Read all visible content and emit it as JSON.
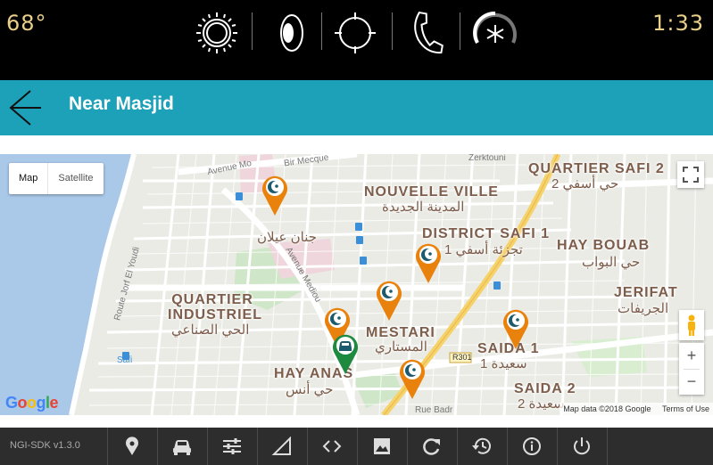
{
  "status": {
    "temperature": "68°",
    "time": "1:33",
    "icons": [
      "sun-icon",
      "speaker-icon",
      "navigation-crosshair-icon",
      "phone-icon",
      "climate-snowflake-icon"
    ]
  },
  "header": {
    "title": "Near Masjid"
  },
  "map": {
    "type_controls": {
      "map": "Map",
      "satellite": "Satellite"
    },
    "districts": [
      {
        "name": "NOUVELLE VILLE",
        "arabic": "المدينة الجديدة"
      },
      {
        "name": "QUARTIER SAFI 2",
        "arabic": "حي أسفي 2"
      },
      {
        "name": "DISTRICT SAFI 1",
        "arabic": "تجزئة أسفي 1"
      },
      {
        "name": "HAY BOUAB",
        "arabic": "حي البواب"
      },
      {
        "name": "JERIFAT",
        "arabic": "الجريفات"
      },
      {
        "name": "QUARTIER INDUSTRIEL",
        "arabic": "الحي الصناعي"
      },
      {
        "name": "MESTARI",
        "arabic": "المستاري"
      },
      {
        "name": "SAIDA 1",
        "arabic": "سعيدة 1"
      },
      {
        "name": "SAIDA 2",
        "arabic": "سعيدة 2"
      },
      {
        "name": "HAY ANAS",
        "arabic": "حي أنس"
      },
      {
        "name": "",
        "arabic": "جنان عيلان"
      }
    ],
    "roads": {
      "avenue_mo": "Avenue Mo",
      "bir_mecque": "Bir Mecque",
      "zerktouni": "Zerktouni",
      "route_jorf": "Route Jorf El Youdi",
      "avenue_medious": "Avenue Mediou",
      "r301": "R301",
      "rue_badr": "Rue Badr",
      "safi": "Safi"
    },
    "mosque_markers": 7,
    "current_location_markers": 1,
    "attribution": {
      "data": "Map data ©2018 Google",
      "terms": "Terms of Use"
    },
    "zoom": {
      "in": "+",
      "out": "−"
    },
    "google": "Google"
  },
  "toolbar": {
    "sdk_version": "NGI-SDK v1.3.0",
    "buttons": [
      "location-pin-icon",
      "car-icon",
      "sliders-icon",
      "signal-icon",
      "code-icon",
      "image-icon",
      "refresh-icon",
      "history-icon",
      "info-icon",
      "power-icon"
    ]
  },
  "colors": {
    "header": "#1da1b8",
    "accent_text": "#e9cf8a",
    "mosque_pin": "#e8820c",
    "location_pin": "#1e8a3f",
    "toolbar_bg": "#2d2d2d"
  }
}
